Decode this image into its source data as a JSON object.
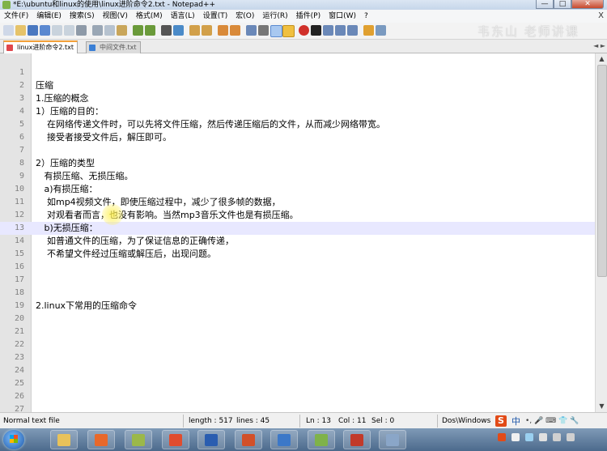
{
  "window": {
    "title": "*E:\\ubuntu和linux的使用\\linux进阶命令2.txt - Notepad++",
    "minimize": "—",
    "maximize": "□",
    "close": "✕"
  },
  "menu": [
    "文件(F)",
    "编辑(E)",
    "搜索(S)",
    "视图(V)",
    "格式(M)",
    "语言(L)",
    "设置(T)",
    "宏(O)",
    "运行(R)",
    "插件(P)",
    "窗口(W)",
    "?"
  ],
  "menu_close": "X",
  "watermark": "韦东山 老师讲课",
  "tabs": [
    {
      "label": "linux进阶命令2.txt",
      "active": true,
      "icon_color": "#e0474c"
    },
    {
      "label": "中间文件.txt",
      "active": false,
      "icon_color": "#3a7fd5"
    }
  ],
  "tab_scroll": "◄ ►",
  "editor": {
    "current_line": 13,
    "lines": [
      {
        "n": "1",
        "text": ""
      },
      {
        "n": "2",
        "text": "压缩"
      },
      {
        "n": "3",
        "text": "1.压缩的概念"
      },
      {
        "n": "4",
        "text": "1）压缩的目的："
      },
      {
        "n": "5",
        "text": "    在网络传递文件时，可以先将文件压缩，然后传递压缩后的文件，从而减少网络带宽。"
      },
      {
        "n": "6",
        "text": "    接受者接受文件后，解压即可。"
      },
      {
        "n": "7",
        "text": ""
      },
      {
        "n": "8",
        "text": "2）压缩的类型"
      },
      {
        "n": "9",
        "text": "   有损压缩、无损压缩。"
      },
      {
        "n": "10",
        "text": "   a)有损压缩："
      },
      {
        "n": "11",
        "text": "    如mp4视频文件，即使压缩过程中，减少了很多帧的数据，"
      },
      {
        "n": "12",
        "text": "    对观看者而言，也没有影响。当然mp3音乐文件也是有损压缩。"
      },
      {
        "n": "13",
        "text": "   b)无损压缩："
      },
      {
        "n": "14",
        "text": "    如普通文件的压缩，为了保证信息的正确传递，"
      },
      {
        "n": "15",
        "text": "    不希望文件经过压缩或解压后，出现问题。"
      },
      {
        "n": "16",
        "text": ""
      },
      {
        "n": "17",
        "text": ""
      },
      {
        "n": "18",
        "text": ""
      },
      {
        "n": "19",
        "text": "2.linux下常用的压缩命令"
      },
      {
        "n": "20",
        "text": ""
      },
      {
        "n": "21",
        "text": ""
      },
      {
        "n": "22",
        "text": ""
      },
      {
        "n": "23",
        "text": ""
      },
      {
        "n": "24",
        "text": ""
      },
      {
        "n": "25",
        "text": ""
      },
      {
        "n": "26",
        "text": ""
      },
      {
        "n": "27",
        "text": ""
      }
    ]
  },
  "status": {
    "file_type": "Normal text file",
    "length": "length : 517",
    "lines": "lines : 45",
    "ln": "Ln : 13",
    "col": "Col : 11",
    "sel": "Sel : 0",
    "eol": "Dos\\Windows"
  },
  "ime": {
    "logo": "S",
    "lang": "中",
    "extras": "•, 🎤 ⌨ 👕 🔧"
  },
  "colors": {
    "current_line": "#e8e8ff",
    "gutter": "#e4e4e4",
    "line_number": "#808080",
    "active_tab_accent": "#f4a13a"
  },
  "taskbar": {
    "apps": [
      {
        "name": "explorer-icon",
        "color": "#e8c25a"
      },
      {
        "name": "firefox-icon",
        "color": "#e8682a"
      },
      {
        "name": "app-icon",
        "color": "#9bb84a"
      },
      {
        "name": "pdf-icon",
        "color": "#e04c2e"
      },
      {
        "name": "word-icon",
        "color": "#2a5db0"
      },
      {
        "name": "powerpoint-icon",
        "color": "#d2502a"
      },
      {
        "name": "app-icon",
        "color": "#3c78c8"
      },
      {
        "name": "notepadpp-icon",
        "color": "#7fb24a"
      },
      {
        "name": "app-icon",
        "color": "#c23a2a"
      },
      {
        "name": "app-icon",
        "color": "#8aa6c8"
      }
    ]
  }
}
